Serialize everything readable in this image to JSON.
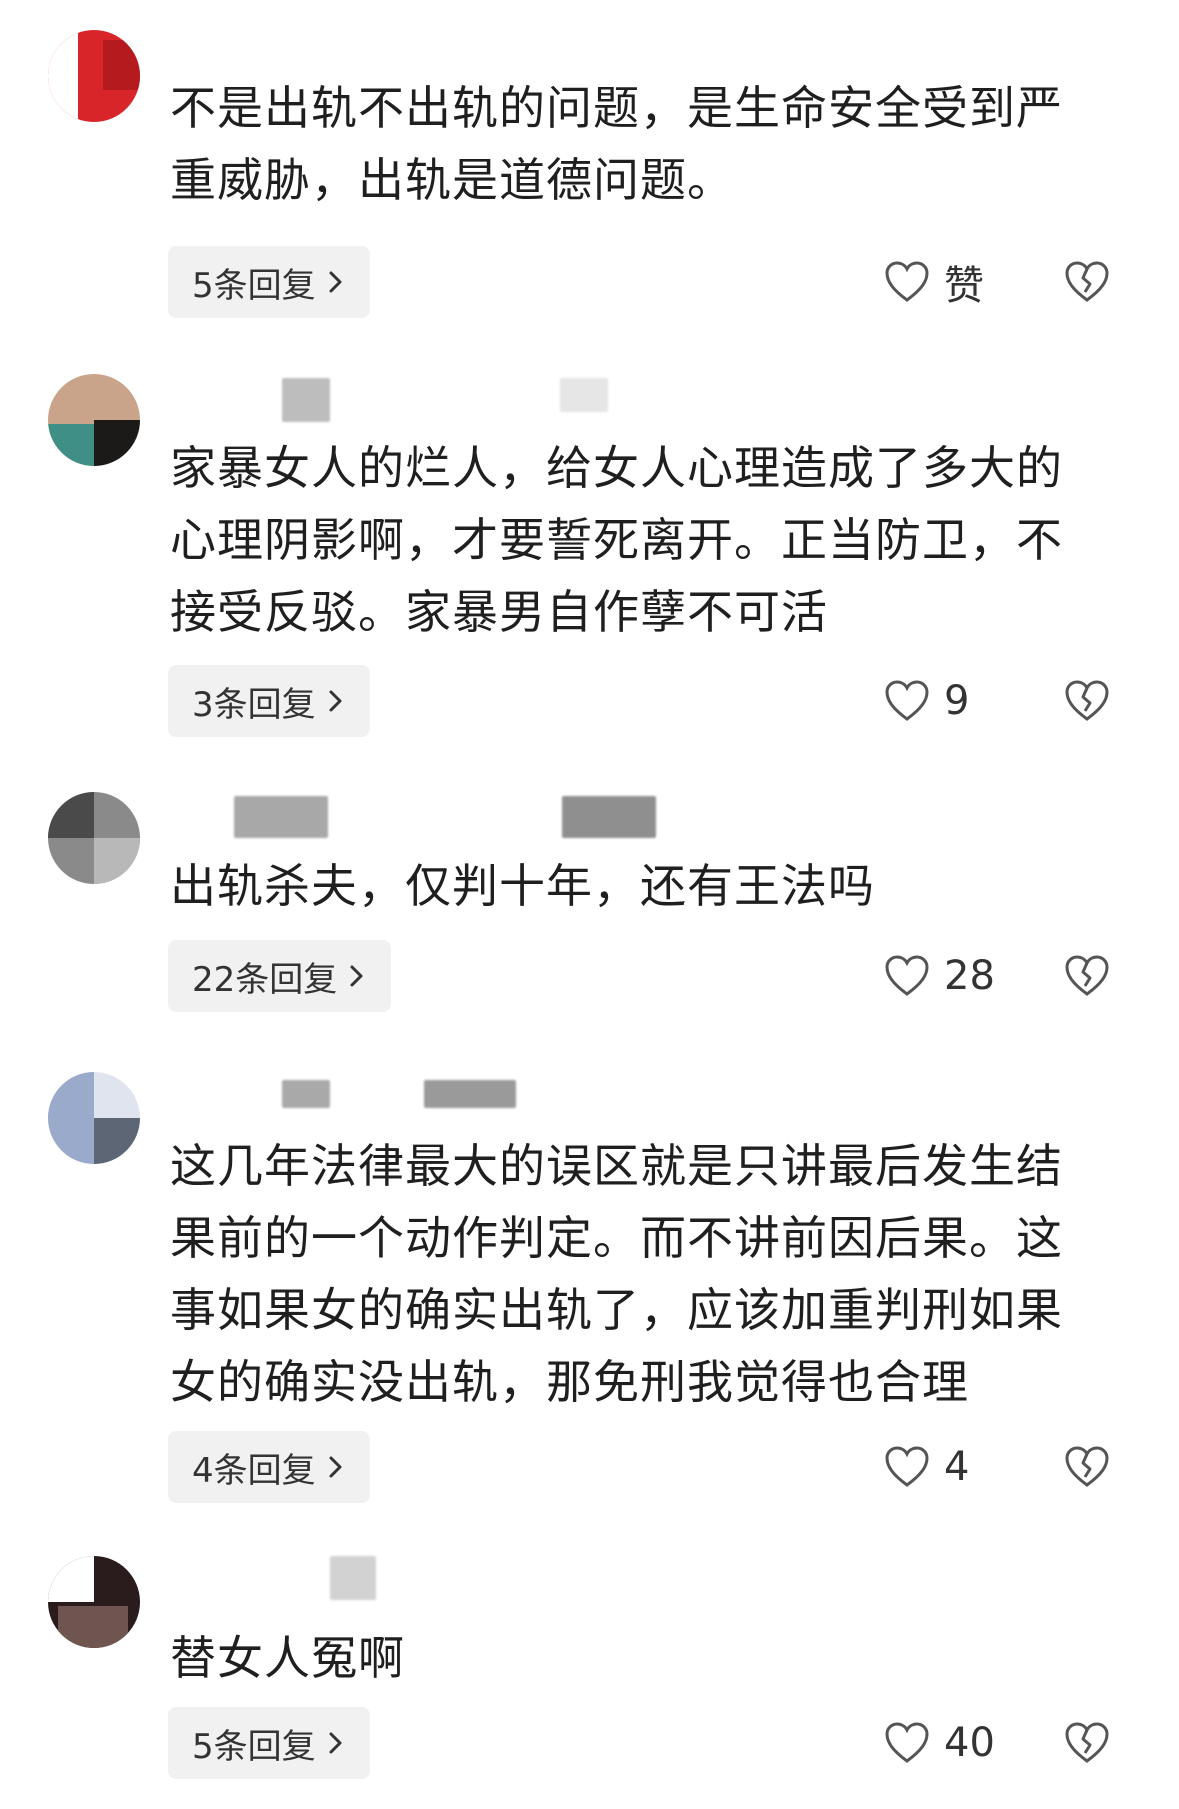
{
  "comments": [
    {
      "text": "不是出轨不出轨的问题，是生命安全受到严重威胁，出轨是道德问题。",
      "reply_label": "5条回复",
      "like": "赞"
    },
    {
      "text": "家暴女人的烂人，给女人心理造成了多大的心理阴影啊，才要誓死离开。正当防卫，不接受反驳。家暴男自作孽不可活",
      "reply_label": "3条回复",
      "like": "9"
    },
    {
      "text": "出轨杀夫，仅判十年，还有王法吗",
      "reply_label": "22条回复",
      "like": "28"
    },
    {
      "text": "这几年法律最大的误区就是只讲最后发生结果前的一个动作判定。而不讲前因后果。这事如果女的确实出轨了，应该加重判刑如果女的确实没出轨，那免刑我觉得也合理",
      "reply_label": "4条回复",
      "like": "4"
    },
    {
      "text": "替女人冤啊",
      "reply_label": "5条回复",
      "like": "40"
    }
  ],
  "icons": {
    "like": "heart-outline-icon",
    "dislike": "broken-heart-icon",
    "chevron": "chevron-right-icon"
  },
  "colors": {
    "reply_bg": "#f1f1f2",
    "text": "#1f1f1f",
    "icon": "#555555"
  }
}
